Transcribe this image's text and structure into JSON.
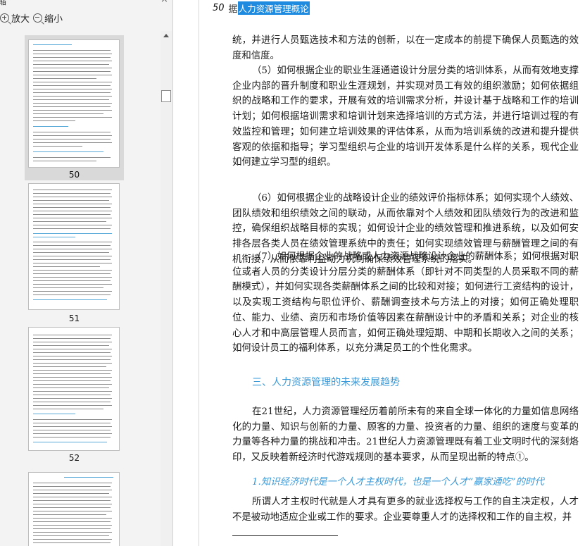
{
  "window": {
    "pane_title": "缩",
    "close_glyph": "×"
  },
  "toolbar": {
    "zoom_in_label": "放大",
    "zoom_out_label": "缩小"
  },
  "thumbnails": [
    {
      "page": "50",
      "selected": true
    },
    {
      "page": "51",
      "selected": false
    },
    {
      "page": "52",
      "selected": false
    }
  ],
  "document": {
    "page_number": "50",
    "header_prefix": "据",
    "header_title": "人力资源管理概论",
    "paragraphs": [
      "统，并进行人员甄选技术和方法的创新，以在一定成本的前提下确保人员甄选的效度和信度。",
      "（5）如何根据企业的职业生涯通道设计分层分类的培训体系，从而有效地支撑企业内部的晋升制度和职业生涯规划，并实现对员工有效的组织激励；如何依据组织的战略和工作的要求，开展有效的培训需求分析，并设计基于战略和工作的培训计划；如何根据培训需求和培训计划来选择培训的方式方法，并进行培训过程的有效监控和管理；如何建立培训效果的评估体系，从而为培训系统的改进和提升提供客观的依据和指导；学习型组织与企业的培训开发体系是什么样的关系，现代企业如何建立学习型的组织。",
      "（6）如何根据企业的战略设计企业的绩效评价指标体系；如何实现个人绩效、团队绩效和组织绩效之间的联动，从而依靠对个人绩效和团队绩效行为的改进和监控，确保组织战略目标的实现；如何设计企业的绩效管理和推进系统，以及如何安排各层各类人员在绩效管理系统中的责任；如何实现绩效管理与薪酬管理之间的有机衔接，从而依靠利益动力机制确保绩效管理系统的落实。",
      "（7）如何根据企业的战略或人力资源战略设计企业的薪酬体系；如何根据对职位或者人员的分类设计分层分类的薪酬体系（即针对不同类型的人员采取不同的薪酬模式），并如何实现各类薪酬体系之间的比较和对接；如何进行工资结构的设计，以及实现工资结构与职位评价、薪酬调查技术与方法上的对接；如何正确处理职位、能力、业绩、资历和市场价值等因素在薪酬设计中的矛盾和关系；对企业的核心人才和中高层管理人员而言，如何正确处理短期、中期和长期收入之间的关系；如何设计员工的福利体系，以充分满足员工的个性化需求。"
    ],
    "section_title": "三、人力资源管理的未来发展趋势",
    "paragraph_after_section": "在21世纪，人力资源管理经历着前所未有的来自全球一体化的力量如信息网络化的力量、知识与创新的力量、顾客的力量、投资者的力量、组织的速度与变革的力量等各种力量的挑战和冲击。21世纪人力资源管理既有着工业文明时代的深刻烙印，又反映着新经济时代游戏规则的基本要求，从而呈现出新的特点①。",
    "subsection_title": "1.知识经济时代是一个人才主权时代，也是一个人才“赢家通吃”的时代",
    "paragraph_last": "所谓人才主权时代就是人才具有更多的就业选择权与工作的自主决定权，人才不是被动地适应企业或工作的要求。企业要尊重人才的选择权和工作的自主权，并"
  }
}
